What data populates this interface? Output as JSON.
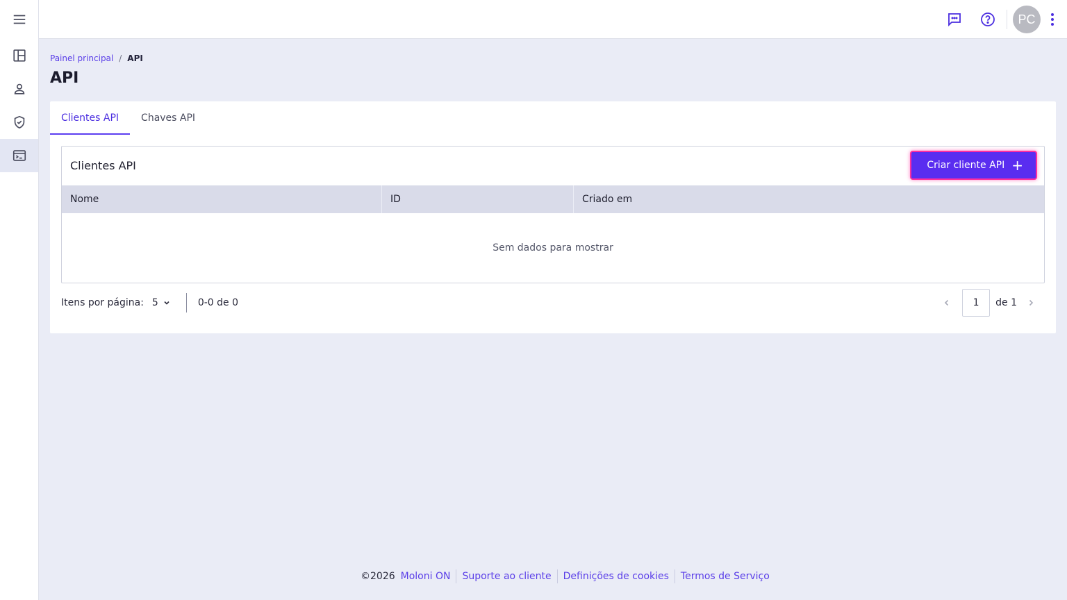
{
  "sidebar": {
    "items": [
      {
        "name": "menu-icon"
      },
      {
        "name": "dashboard-icon"
      },
      {
        "name": "user-icon"
      },
      {
        "name": "shield-icon"
      },
      {
        "name": "terminal-icon"
      }
    ]
  },
  "topbar": {
    "avatar_initials": "PC",
    "icons": [
      "chat-icon",
      "help-icon",
      "more-vert-icon"
    ]
  },
  "breadcrumb": {
    "home": "Painel principal",
    "separator": "/",
    "current": "API"
  },
  "page": {
    "title": "API"
  },
  "tabs": [
    {
      "label": "Clientes API",
      "active": true
    },
    {
      "label": "Chaves API",
      "active": false
    }
  ],
  "panel": {
    "title": "Clientes API",
    "create_button": "Criar cliente API",
    "columns": [
      "Nome",
      "ID",
      "Criado em"
    ],
    "empty_text": "Sem dados para mostrar"
  },
  "pager": {
    "items_per_page_label": "Itens por página:",
    "items_per_page_value": "5",
    "range": "0-0 de 0",
    "page_value": "1",
    "page_total": "de 1"
  },
  "footer": {
    "copyright": "©2026",
    "links": [
      "Moloni ON",
      "Suporte ao cliente",
      "Definições de cookies",
      "Termos de Serviço"
    ]
  },
  "colors": {
    "accent": "#5a2df0",
    "highlight": "#ff2ea0",
    "background": "#eaecf6"
  }
}
